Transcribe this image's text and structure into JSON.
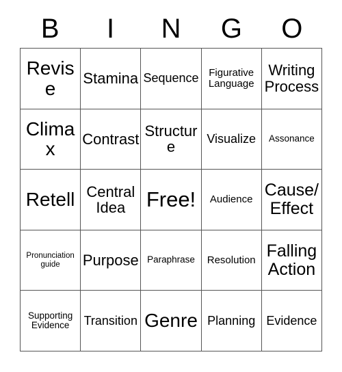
{
  "card": {
    "title": "BINGO Card",
    "background_color": "#ffffff",
    "border_color": "#555555",
    "text_color": "#000000"
  },
  "header": {
    "letters": [
      "B",
      "I",
      "N",
      "G",
      "O"
    ]
  },
  "grid": {
    "rows": 5,
    "columns": 5,
    "cells": [
      [
        {
          "text": "Revise",
          "size": "xl"
        },
        {
          "text": "Stamina",
          "size": "md"
        },
        {
          "text": "Sequence",
          "size": "sm"
        },
        {
          "text": "Figurative Language",
          "size": "xs"
        },
        {
          "text": "Writing Process",
          "size": "md"
        }
      ],
      [
        {
          "text": "Climax",
          "size": "xl"
        },
        {
          "text": "Contrast",
          "size": "md"
        },
        {
          "text": "Structure",
          "size": "md"
        },
        {
          "text": "Visualize",
          "size": "sm"
        },
        {
          "text": "Assonance",
          "size": "xxs"
        }
      ],
      [
        {
          "text": "Retell",
          "size": "xl"
        },
        {
          "text": "Central Idea",
          "size": "md"
        },
        {
          "text": "Free!",
          "size": "xxl"
        },
        {
          "text": "Audience",
          "size": "xs"
        },
        {
          "text": "Cause/Effect",
          "size": "lg"
        }
      ],
      [
        {
          "text": "Pronunciation guide",
          "size": "tiny"
        },
        {
          "text": "Purpose",
          "size": "md"
        },
        {
          "text": "Paraphrase",
          "size": "xxs"
        },
        {
          "text": "Resolution",
          "size": "xs"
        },
        {
          "text": "Falling Action",
          "size": "lg"
        }
      ],
      [
        {
          "text": "Supporting Evidence",
          "size": "xxs"
        },
        {
          "text": "Transition",
          "size": "sm"
        },
        {
          "text": "Genre",
          "size": "xl"
        },
        {
          "text": "Planning",
          "size": "sm"
        },
        {
          "text": "Evidence",
          "size": "sm"
        }
      ]
    ]
  }
}
